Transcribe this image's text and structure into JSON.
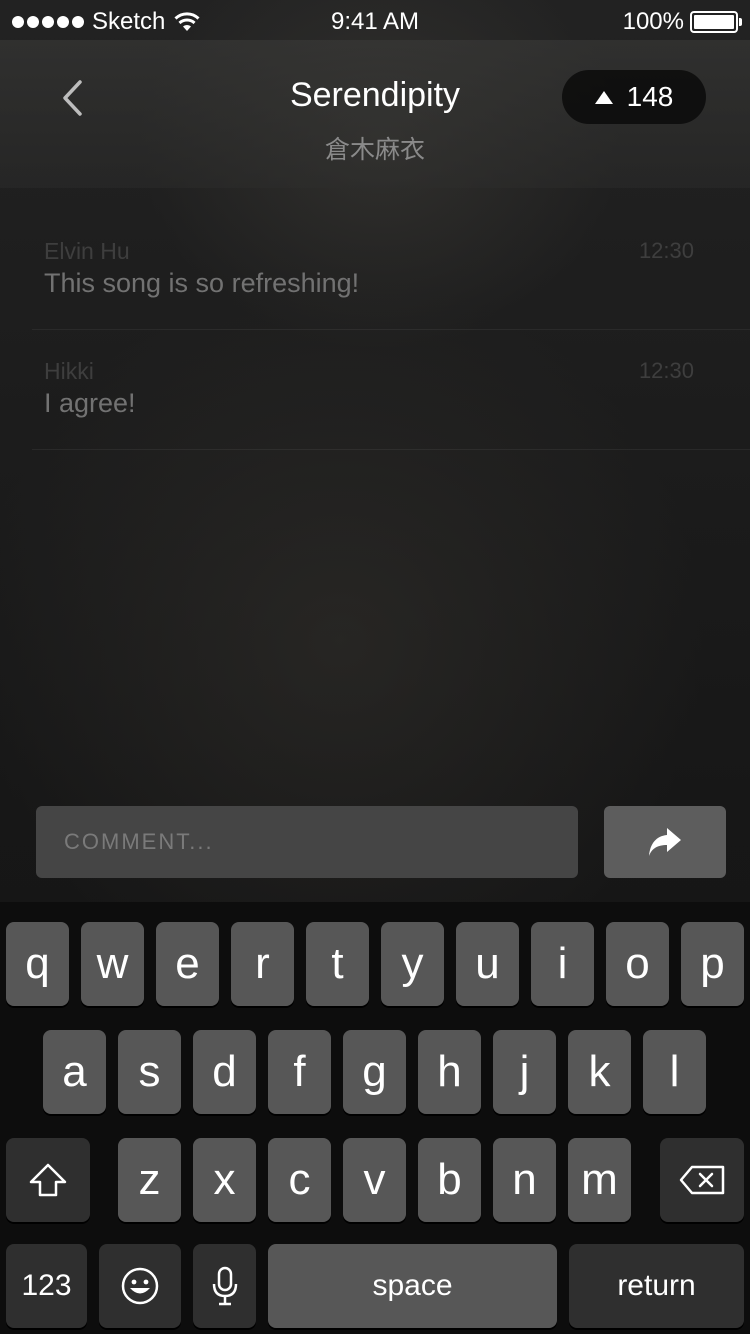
{
  "status_bar": {
    "carrier": "Sketch",
    "time": "9:41 AM",
    "battery": "100%"
  },
  "header": {
    "title": "Serendipity",
    "artist": "倉木麻衣",
    "upvotes": "148"
  },
  "comments": [
    {
      "author": "Elvin Hu",
      "time": "12:30",
      "text": "This song is so refreshing!"
    },
    {
      "author": "Hikki",
      "time": "12:30",
      "text": "I agree!"
    }
  ],
  "composer": {
    "placeholder": "COMMENT..."
  },
  "keyboard": {
    "row1": [
      "q",
      "w",
      "e",
      "r",
      "t",
      "y",
      "u",
      "i",
      "o",
      "p"
    ],
    "row2": [
      "a",
      "s",
      "d",
      "f",
      "g",
      "h",
      "j",
      "k",
      "l"
    ],
    "row3": [
      "z",
      "x",
      "c",
      "v",
      "b",
      "n",
      "m"
    ],
    "numbers_label": "123",
    "space_label": "space",
    "return_label": "return"
  }
}
